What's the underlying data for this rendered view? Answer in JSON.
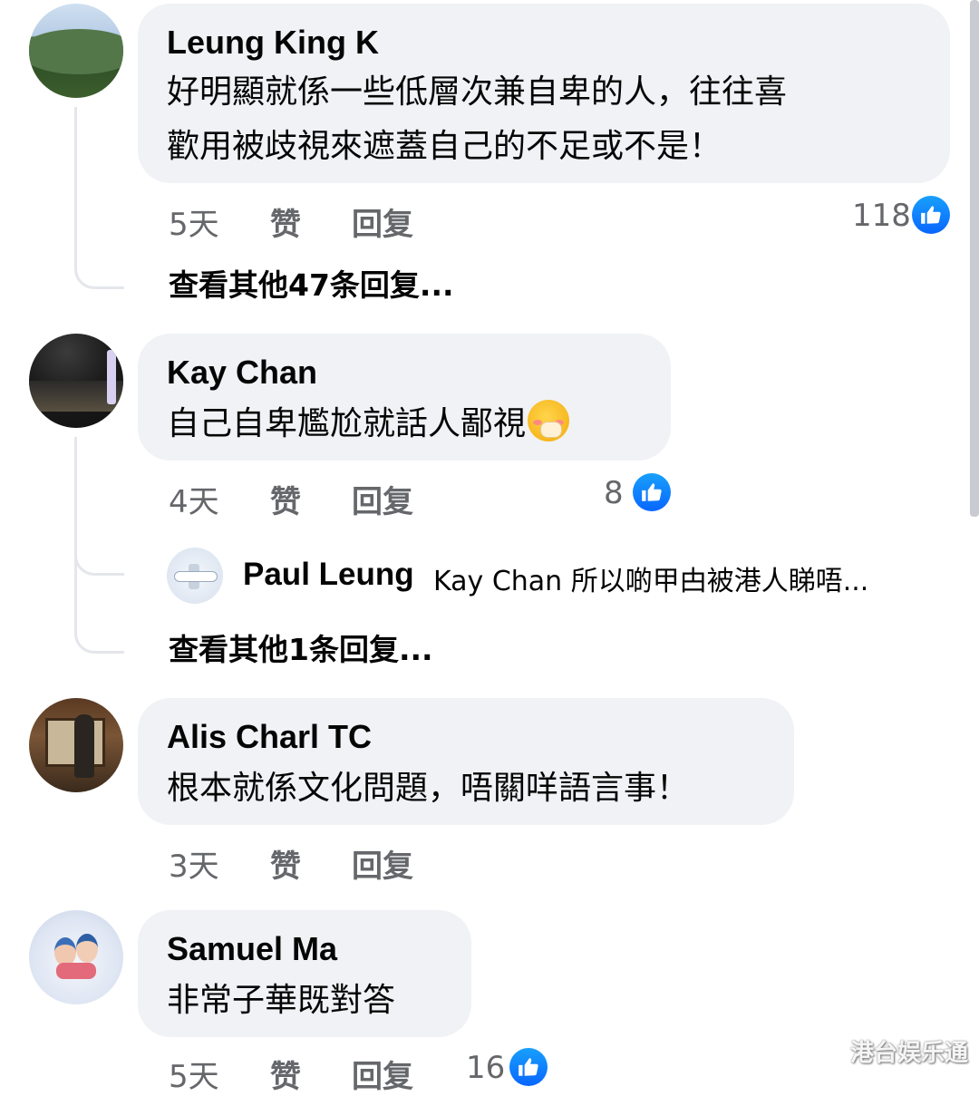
{
  "comments": [
    {
      "name": "Leung King K",
      "line1": "好明顯就係一些低層次兼自卑的人，往往喜",
      "line2": "歡用被歧視來遮蓋自己的不足或不是！",
      "time": "5天",
      "like": "赞",
      "reply": "回复",
      "likes": "118",
      "more": "查看其他47条回复..."
    },
    {
      "name": "Kay Chan",
      "line1": "自己自卑尷尬就話人鄙視",
      "time": "4天",
      "like": "赞",
      "reply": "回复",
      "likes": "8",
      "sub_reply": {
        "name": "Paul Leung",
        "text": "Kay Chan 所以啲甲甴被港人睇唔..."
      },
      "more": "查看其他1条回复..."
    },
    {
      "name": "Alis Charl TC",
      "line1": "根本就係文化問題，唔關咩語言事！",
      "time": "3天",
      "like": "赞",
      "reply": "回复"
    },
    {
      "name": "Samuel Ma",
      "line1": "非常子華既對答",
      "time": "5天",
      "like": "赞",
      "reply": "回复",
      "likes": "16"
    }
  ],
  "watermark": "港台娱乐通",
  "colors": {
    "bubble": "#f0f2f5",
    "meta": "#65676b",
    "like_blue": "#0866ff"
  }
}
